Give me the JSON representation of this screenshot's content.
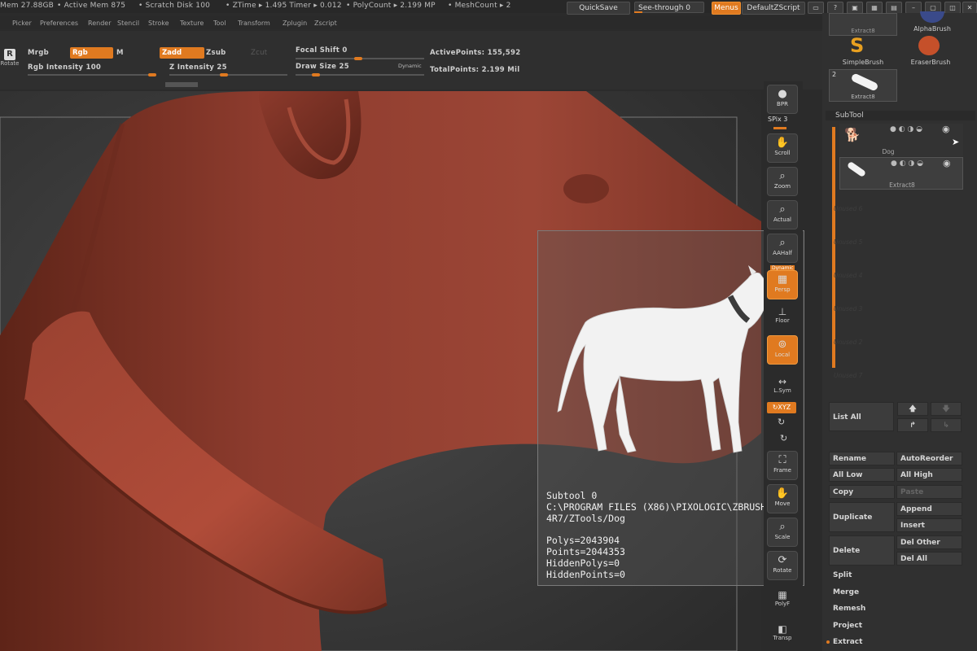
{
  "status": {
    "mem": "Mem 27.88GB",
    "active_mem": "• Active Mem 875",
    "scratch": "• Scratch Disk 100",
    "ztime": "• ZTime ▸ 1.495 Timer ▸ 0.012",
    "polycount": "• PolyCount ▸ 2.199 MP",
    "meshcount": "• MeshCount ▸ 2",
    "quicksave": "QuickSave",
    "see_through": "See-through  0",
    "menus": "Menus",
    "default_zscript": "DefaultZScript"
  },
  "menus": [
    "Picker",
    "Preferences",
    "Render",
    "Stencil",
    "Stroke",
    "Texture",
    "Tool",
    "Transform",
    "Zplugin",
    "Zscript"
  ],
  "shelf": {
    "rotate": "Rotate",
    "mrgb": "Mrgb",
    "rgb": "Rgb",
    "m": "M",
    "rgb_intensity": "Rgb Intensity 100",
    "zadd": "Zadd",
    "zsub": "Zsub",
    "zcut": "Zcut",
    "z_intensity": "Z Intensity 25",
    "focal_shift": "Focal Shift 0",
    "draw_size": "Draw Size 25",
    "dynamic": "Dynamic",
    "active_points": "ActivePoints: 155,592",
    "total_points": "TotalPoints: 2.199 Mil"
  },
  "right_tools": {
    "bpr": "BPR",
    "spix": "SPix 3",
    "scroll": "Scroll",
    "zoom": "Zoom",
    "actual": "Actual",
    "aahalf": "AAHalf",
    "dynamic": "Dynamic",
    "persp": "Persp",
    "floor": "Floor",
    "local": "Local",
    "lsym": "L.Sym",
    "xyz": "XYZ",
    "frame": "Frame",
    "move": "Move",
    "scale": "Scale",
    "rotate": "Rotate",
    "polyf": "PolyF",
    "transp": "Transp"
  },
  "brushes": {
    "extract_top": "Extract8",
    "alpha": "AlphaBrush",
    "simple": "SimpleBrush",
    "eraser": "EraserBrush",
    "extract": "Extract8",
    "count": "2"
  },
  "subtool": {
    "header": "SubTool",
    "items": [
      {
        "name": "Dog"
      },
      {
        "name": "Extract8"
      }
    ],
    "empty_slots": [
      "Unused 6",
      "Unused 5",
      "Unused 4",
      "Unused 3",
      "Unused 2",
      "Unused 1",
      "Unused 7"
    ],
    "list_all": "List All",
    "rename": "Rename",
    "auto_reorder": "AutoReorder",
    "all_low": "All Low",
    "all_high": "All High",
    "copy": "Copy",
    "paste": "Paste",
    "duplicate": "Duplicate",
    "append": "Append",
    "insert": "Insert",
    "delete": "Delete",
    "del_other": "Del Other",
    "del_all": "Del All",
    "split": "Split",
    "merge": "Merge",
    "remesh": "Remesh",
    "project": "Project",
    "extract": "Extract"
  },
  "info": {
    "subtool": "Subtool 0",
    "path1": "C:\\PROGRAM FILES (X86)\\PIXOLOGIC\\ZBRUSH",
    "path2": "4R7/ZTools/Dog",
    "polys": "Polys=2043904",
    "points": "Points=2044353",
    "hidden_polys": "HiddenPolys=0",
    "hidden_points": "HiddenPoints=0"
  },
  "colors": {
    "accent": "#e07a20",
    "clay": "#8a3a2c",
    "panel": "#303030"
  }
}
